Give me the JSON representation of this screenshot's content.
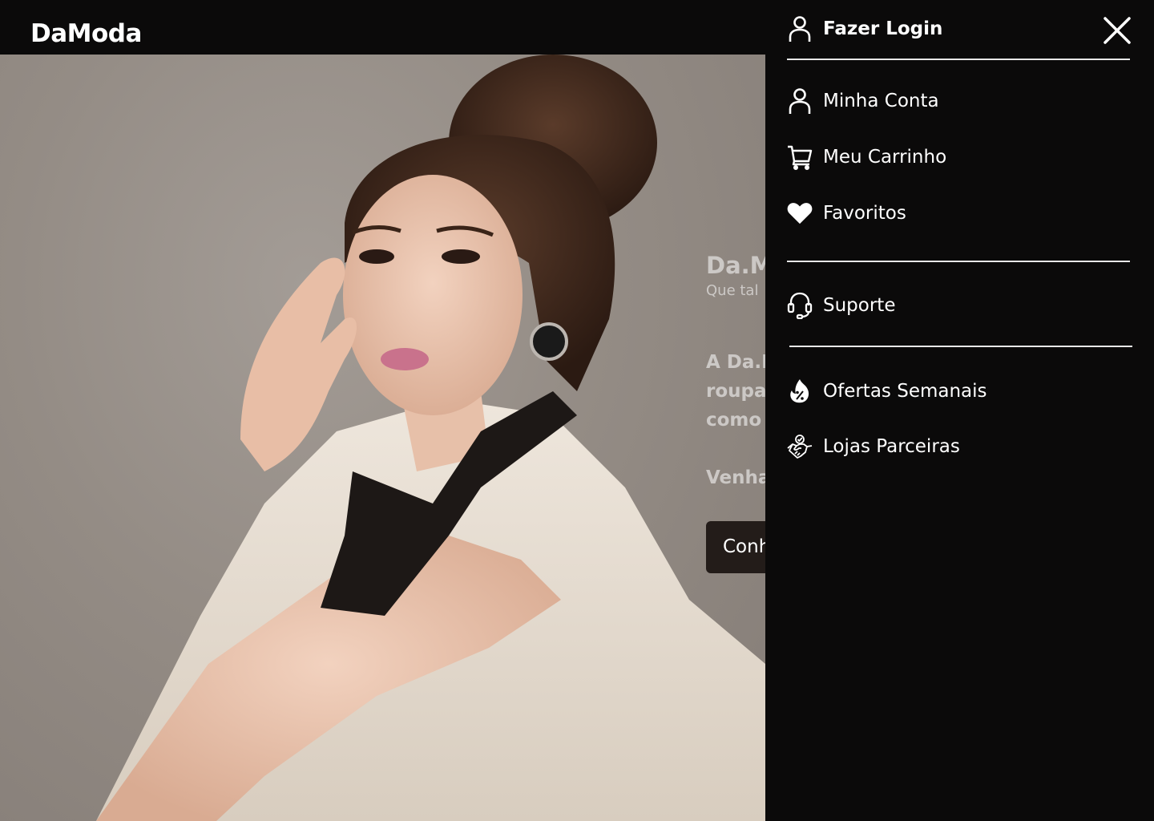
{
  "header": {
    "logo_text": "DaModa"
  },
  "hero": {
    "title": "Da.M",
    "subtitle": "Que tal",
    "paragraph_lines": [
      "A Da.M",
      "roupa",
      "como"
    ],
    "invite_line": "Venha",
    "cta_label": "Conh",
    "cta_color": "#231c19"
  },
  "menu": {
    "login_label": "Fazer Login",
    "account_items": [
      {
        "label": "Minha Conta",
        "icon": "user-icon"
      },
      {
        "label": "Meu Carrinho",
        "icon": "cart-icon"
      },
      {
        "label": "Favoritos",
        "icon": "heart-icon"
      }
    ],
    "support_label": "Suporte",
    "extra_items": [
      {
        "label": "Ofertas Semanais",
        "icon": "discount-fire-icon"
      },
      {
        "label": "Lojas Parceiras",
        "icon": "handshake-icon"
      }
    ],
    "close_icon": "close-icon",
    "background_color": "#0b0a0a",
    "text_color": "#ffffff"
  }
}
